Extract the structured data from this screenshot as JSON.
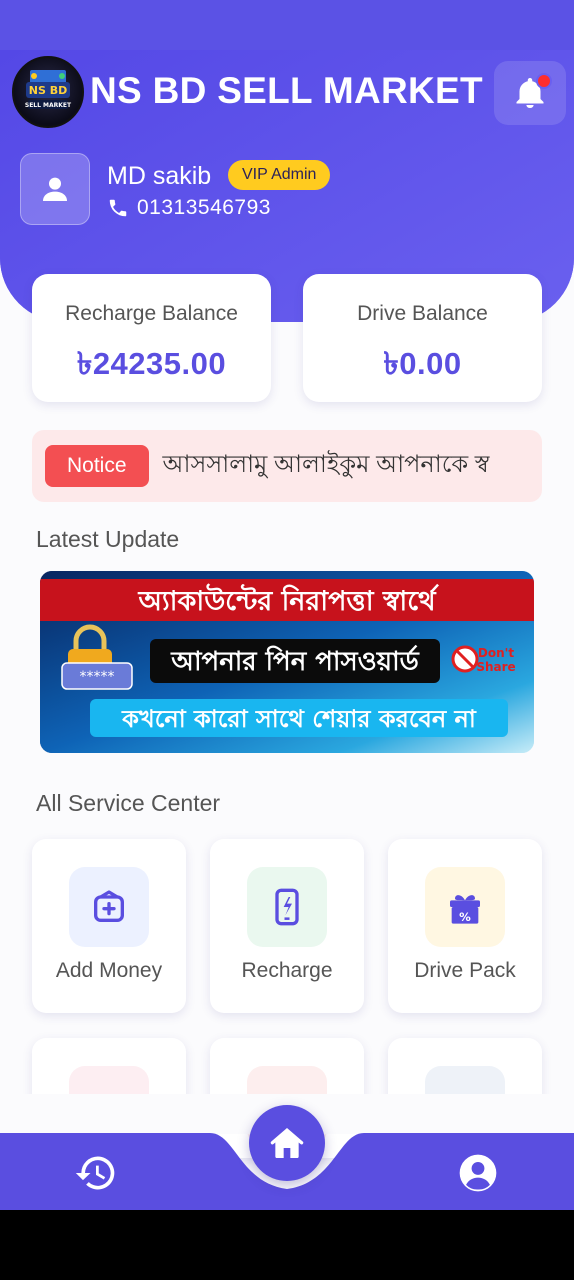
{
  "header": {
    "title": "NS BD SELL MARKET",
    "logo_text": "NS BD SELL MARKET"
  },
  "user": {
    "name": "MD sakib",
    "badge": "VIP Admin",
    "phone": "01313546793"
  },
  "balances": [
    {
      "label": "Recharge Balance",
      "value": "৳24235.00"
    },
    {
      "label": "Drive Balance",
      "value": "৳0.00"
    }
  ],
  "notice": {
    "tag": "Notice",
    "text": "আসসালামু আলাইকুম আপনাকে স্ব"
  },
  "latest_update": {
    "title": "Latest Update",
    "banner_line1": "অ্যাকাউন্টের নিরাপত্তা স্বার্থে",
    "banner_line2": "আপনার পিন পাসওয়ার্ড",
    "banner_line3": "কখনো কারো সাথে শেয়ার করবেন না",
    "banner_badge_1": "Don't",
    "banner_badge_2": "Share",
    "banner_pin_mask": "*****"
  },
  "services": {
    "title": "All Service Center",
    "items": [
      {
        "label": "Add Money",
        "icon": "wallet-plus-icon"
      },
      {
        "label": "Recharge",
        "icon": "phone-charge-icon"
      },
      {
        "label": "Drive Pack",
        "icon": "gift-percent-icon"
      }
    ]
  },
  "nav": {
    "items": [
      "history-icon",
      "home-icon",
      "profile-icon"
    ]
  },
  "colors": {
    "primary": "#5a4ee0",
    "badge": "#ffcb1f",
    "notice_tag": "#f34f52",
    "notice_bg": "#fde9ea"
  }
}
